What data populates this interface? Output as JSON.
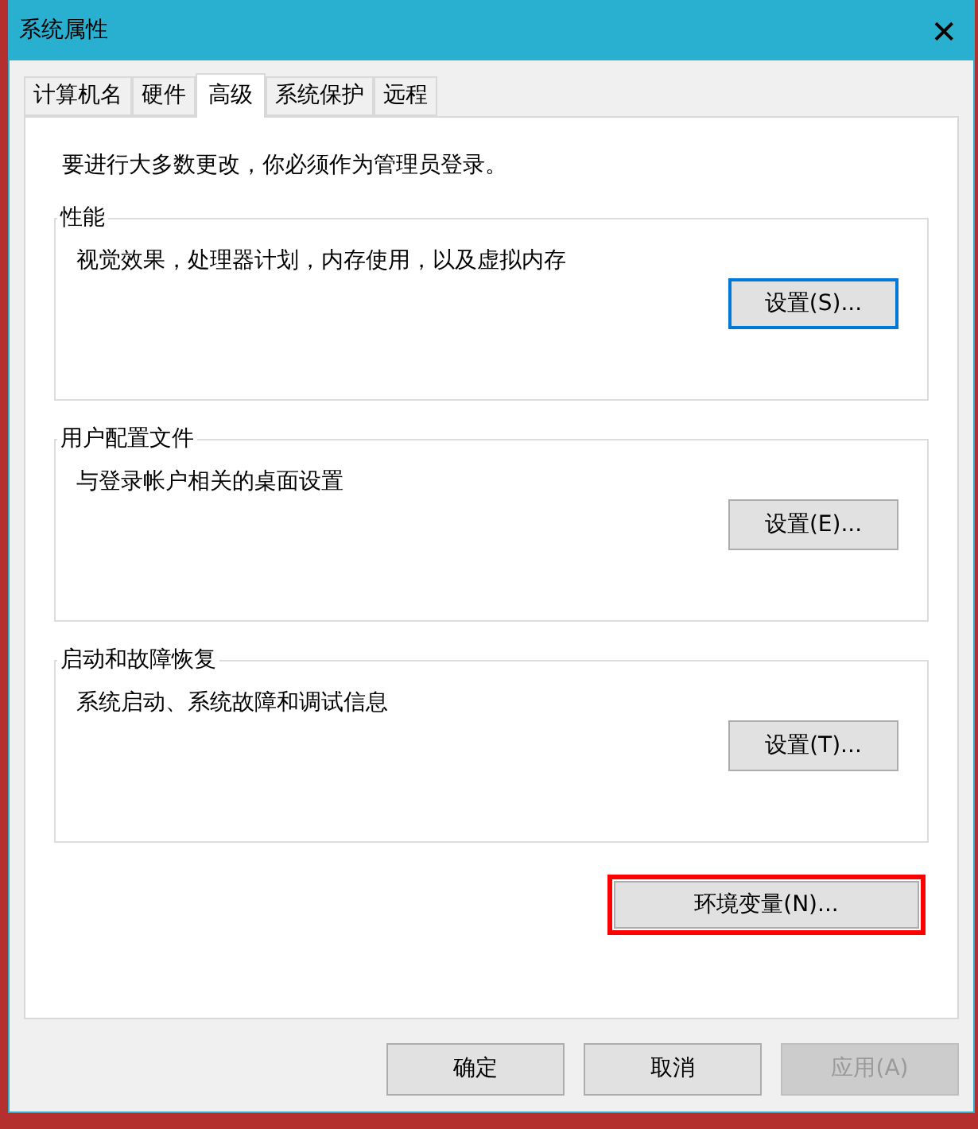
{
  "window": {
    "title": "系统属性",
    "close": "✕"
  },
  "tabs": [
    {
      "label": "计算机名",
      "selected": false
    },
    {
      "label": "硬件",
      "selected": false
    },
    {
      "label": "高级",
      "selected": true
    },
    {
      "label": "系统保护",
      "selected": false
    },
    {
      "label": "远程",
      "selected": false
    }
  ],
  "notice": "要进行大多数更改，你必须作为管理员登录。",
  "groups": [
    {
      "title": "性能",
      "description": "视觉效果，处理器计划，内存使用，以及虚拟内存",
      "button": {
        "label": "设置(S)...",
        "focused": true
      }
    },
    {
      "title": "用户配置文件",
      "description": "与登录帐户相关的桌面设置",
      "button": {
        "label": "设置(E)...",
        "focused": false
      }
    },
    {
      "title": "启动和故障恢复",
      "description": "系统启动、系统故障和调试信息",
      "button": {
        "label": "设置(T)...",
        "focused": false
      }
    }
  ],
  "environment_button": {
    "label": "环境变量(N)...",
    "highlighted": true
  },
  "buttons": [
    {
      "label": "确定",
      "disabled": false
    },
    {
      "label": "取消",
      "disabled": false
    },
    {
      "label": "应用(A)",
      "disabled": true
    }
  ]
}
